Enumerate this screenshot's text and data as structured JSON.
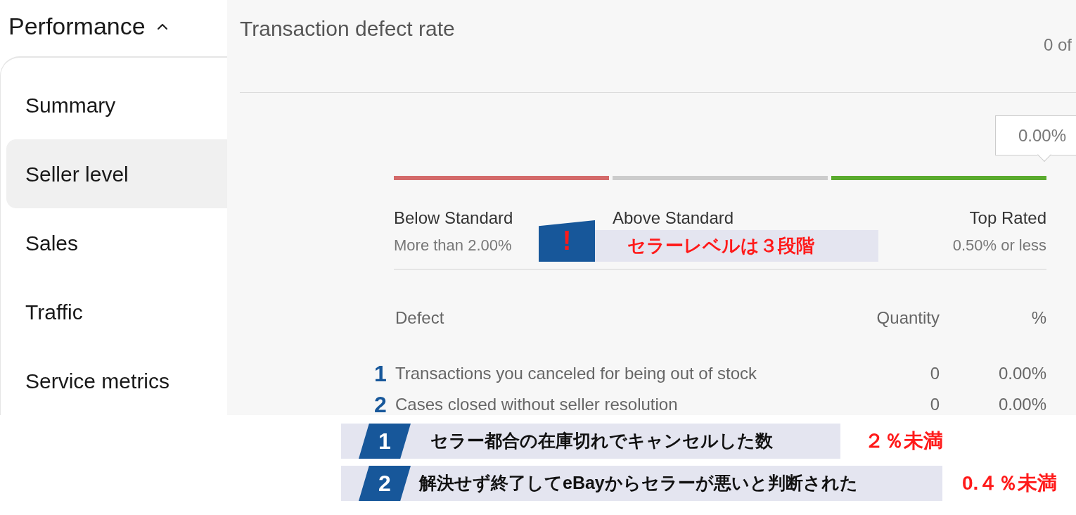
{
  "sidebar": {
    "title": "Performance",
    "expanded": true,
    "items": [
      {
        "label": "Summary",
        "selected": false
      },
      {
        "label": "Seller level",
        "selected": true
      },
      {
        "label": "Sales",
        "selected": false
      },
      {
        "label": "Traffic",
        "selected": false
      },
      {
        "label": "Service metrics",
        "selected": false
      }
    ]
  },
  "main": {
    "title": "Transaction defect rate",
    "count": "0 of",
    "rate_badge": "0.00%",
    "tiers": [
      {
        "name": "Below Standard",
        "threshold": "More than 2.00%",
        "color": "#d46a6a"
      },
      {
        "name": "Above Standard",
        "color": "#cccccc"
      },
      {
        "name": "Top Rated",
        "threshold": "0.50% or less",
        "color": "#5aab2e"
      }
    ],
    "table": {
      "columns": [
        "Defect",
        "Quantity",
        "%"
      ],
      "rows": [
        {
          "marker": "1",
          "defect": "Transactions you canceled for being out of stock",
          "quantity": "0",
          "percent": "0.00%"
        },
        {
          "marker": "2",
          "defect": "Cases closed without seller resolution",
          "quantity": "0",
          "percent": "0.00%"
        }
      ]
    }
  },
  "callout": {
    "icon": "!",
    "text": "セラーレベルは３段階"
  },
  "notes": [
    {
      "number": "1",
      "text": "セラー都合の在庫切れでキャンセルした数",
      "limit": "２％未満"
    },
    {
      "number": "2",
      "text": "解決せず終了してeBayからセラーが悪いと判断された",
      "limit": "0.４％未満"
    }
  ]
}
